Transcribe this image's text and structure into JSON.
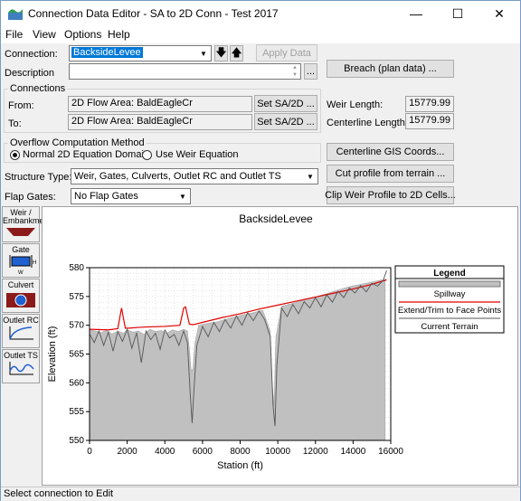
{
  "window": {
    "title": "Connection Data Editor - SA to 2D Conn - Test 2017",
    "minimize": "—",
    "maximize": "☐",
    "close": "✕"
  },
  "menu": {
    "file": "File",
    "view": "View",
    "options": "Options",
    "help": "Help"
  },
  "connection": {
    "label": "Connection:",
    "value": "BacksideLevee",
    "apply_label": "Apply Data"
  },
  "description": {
    "label": "Description",
    "value": "",
    "more": "..."
  },
  "buttons": {
    "breach": "Breach (plan data) ...",
    "set_from": "Set SA/2D ...",
    "set_to": "Set SA/2D ...",
    "gis": "Centerline GIS Coords...",
    "cut_profile": "Cut profile from terrain ...",
    "clip_weir": "Clip Weir Profile to 2D Cells..."
  },
  "connections_group": {
    "title": "Connections",
    "from_label": "From:",
    "from_value": "2D Flow Area: BaldEagleCr",
    "to_label": "To:",
    "to_value": "2D Flow Area: BaldEagleCr"
  },
  "weir": {
    "length_label": "Weir Length:",
    "length_value": "15779.99",
    "cl_label": "Centerline Length:",
    "cl_value": "15779.99"
  },
  "overflow": {
    "title": "Overflow Computation Method",
    "opt1": "Normal 2D Equation Domain",
    "opt2": "Use Weir Equation",
    "selected": "opt1"
  },
  "structure": {
    "label": "Structure Type:",
    "value": "Weir, Gates, Culverts, Outlet RC and Outlet TS"
  },
  "flap": {
    "label": "Flap Gates:",
    "value": "No Flap Gates"
  },
  "tools": {
    "weir": "Weir / Embankment",
    "gate": "Gate",
    "culvert": "Culvert",
    "outlet_rc": "Outlet RC",
    "outlet_ts": "Outlet TS"
  },
  "status": "Select connection to Edit",
  "chart_data": {
    "type": "line",
    "title": "BacksideLevee",
    "xlabel": "Station (ft)",
    "ylabel": "Elevation (ft)",
    "xlim": [
      0,
      16000
    ],
    "ylim": [
      550,
      580
    ],
    "xticks": [
      0,
      2000,
      4000,
      6000,
      8000,
      10000,
      12000,
      14000,
      16000
    ],
    "yticks": [
      550,
      555,
      560,
      565,
      570,
      575,
      580
    ],
    "grid": true,
    "legend": {
      "title": "Legend",
      "placement": "right"
    },
    "series": [
      {
        "name": "Spillway",
        "color": "#c0c0c0",
        "x": [
          0,
          300,
          600,
          900,
          1200,
          1500,
          1800,
          2000,
          2300,
          2600,
          2900,
          3200,
          3500,
          3800,
          4100,
          4400,
          4700,
          5000,
          5200,
          5300,
          5400,
          5500,
          5600,
          5800,
          6200,
          6800,
          7400,
          8000,
          8600,
          9200,
          9600,
          9700,
          9800,
          9900,
          10200,
          10800,
          11400,
          12000,
          12600,
          13200,
          13800,
          14400,
          15000,
          15400,
          15700
        ],
        "y": [
          569.2,
          569.0,
          568.7,
          569.1,
          568.5,
          569.0,
          568.6,
          569.2,
          568.8,
          569.0,
          568.4,
          569.3,
          568.9,
          569.1,
          568.6,
          569.2,
          568.9,
          569.3,
          569.0,
          566.0,
          562.0,
          562.5,
          567.0,
          570.0,
          570.3,
          570.6,
          571.2,
          571.7,
          572.1,
          572.6,
          569.0,
          560.0,
          556.0,
          568.0,
          573.3,
          573.8,
          574.4,
          574.9,
          575.5,
          576.1,
          576.7,
          577.1,
          577.5,
          577.8,
          577.9
        ]
      },
      {
        "name": "Extend/Trim to Face Points",
        "color": "#e00000",
        "x": [
          0,
          1000,
          1500,
          1700,
          1900,
          2100,
          2500,
          3000,
          4000,
          4800,
          5000,
          5100,
          5300,
          5500,
          6000,
          7000,
          8000,
          9000,
          10000,
          11000,
          12000,
          13000,
          14000,
          15000,
          15779.99
        ],
        "y": [
          569.3,
          569.2,
          569.4,
          573.0,
          569.5,
          569.5,
          569.6,
          569.7,
          569.8,
          570.0,
          573.0,
          573.2,
          570.2,
          570.1,
          570.5,
          571.3,
          572.0,
          572.8,
          573.5,
          574.2,
          574.9,
          575.6,
          576.3,
          577.1,
          577.9
        ]
      },
      {
        "name": "Current Terrain",
        "color": "#555555",
        "x": [
          0,
          250,
          500,
          750,
          1000,
          1250,
          1500,
          1750,
          2000,
          2250,
          2500,
          2750,
          3000,
          3250,
          3500,
          3750,
          4000,
          4250,
          4500,
          4750,
          5000,
          5200,
          5350,
          5450,
          5550,
          5700,
          6000,
          6300,
          6600,
          6900,
          7200,
          7500,
          7800,
          8100,
          8400,
          8700,
          9000,
          9300,
          9600,
          9750,
          9850,
          9950,
          10200,
          10500,
          10800,
          11100,
          11400,
          11700,
          12000,
          12300,
          12600,
          12900,
          13200,
          13500,
          13800,
          14100,
          14400,
          14700,
          15000,
          15300,
          15600,
          15779.99
        ],
        "y": [
          568.5,
          567.0,
          569.0,
          566.5,
          568.8,
          565.5,
          568.9,
          567.2,
          569.3,
          566.0,
          568.7,
          563.5,
          569.0,
          567.5,
          568.6,
          565.8,
          569.2,
          567.8,
          568.4,
          566.5,
          569.0,
          567.0,
          558.0,
          553.0,
          559.0,
          566.5,
          569.8,
          568.0,
          570.5,
          568.9,
          571.0,
          569.5,
          571.6,
          570.0,
          572.2,
          570.8,
          572.5,
          571.0,
          568.0,
          556.0,
          552.5,
          563.0,
          573.0,
          571.5,
          573.6,
          572.0,
          574.1,
          573.0,
          574.8,
          573.2,
          575.3,
          574.0,
          575.9,
          574.8,
          576.5,
          575.6,
          576.9,
          575.8,
          577.3,
          576.8,
          577.8,
          579.5
        ]
      }
    ]
  }
}
